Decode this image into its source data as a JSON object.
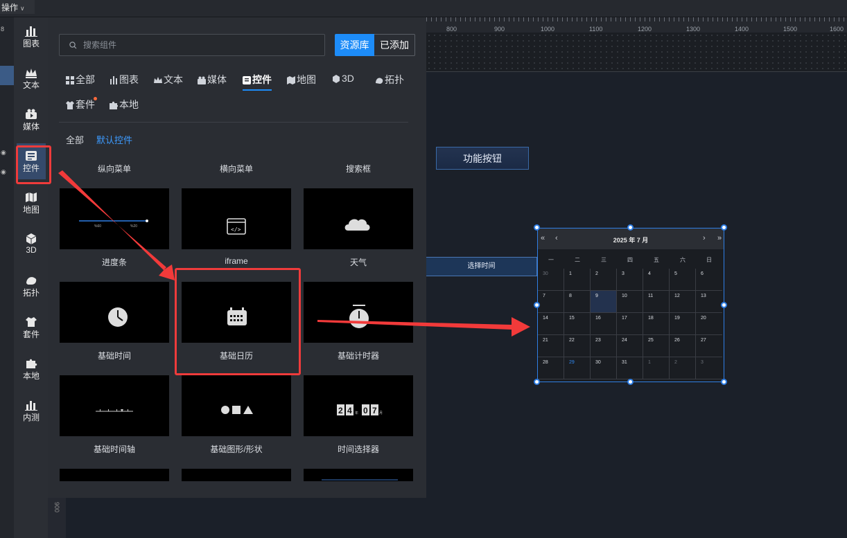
{
  "topbar": {
    "menu_label": "操作"
  },
  "rail": [
    {
      "label": "图表",
      "icon": "bar-chart-icon"
    },
    {
      "label": "文本",
      "icon": "crown-text-icon"
    },
    {
      "label": "媒体",
      "icon": "media-icon"
    },
    {
      "label": "控件",
      "icon": "widget-icon"
    },
    {
      "label": "地图",
      "icon": "map-icon"
    },
    {
      "label": "3D",
      "icon": "cube-icon"
    },
    {
      "label": "拓扑",
      "icon": "topology-icon"
    },
    {
      "label": "套件",
      "icon": "shirt-suite-icon"
    },
    {
      "label": "本地",
      "icon": "puzzle-icon"
    },
    {
      "label": "内测",
      "icon": "beta-chart-icon"
    }
  ],
  "panel": {
    "search_placeholder": "搜索组件",
    "btn_library": "资源库",
    "btn_added": "已添加",
    "categories": [
      "全部",
      "图表",
      "文本",
      "媒体",
      "控件",
      "地图",
      "3D",
      "拓扑",
      "套件",
      "本地"
    ],
    "subcategories": [
      "全部",
      "默认控件"
    ],
    "top_labels": [
      "纵向菜单",
      "横向菜单",
      "搜索框"
    ],
    "components": [
      {
        "label": "进度条"
      },
      {
        "label": "iframe"
      },
      {
        "label": "天气"
      },
      {
        "label": "基础时间"
      },
      {
        "label": "基础日历"
      },
      {
        "label": "基础计时器"
      },
      {
        "label": "基础时间轴"
      },
      {
        "label": "基础图形/形状"
      },
      {
        "label": "时间选择器"
      }
    ],
    "thumb_texts": {
      "progress_a": "%60",
      "progress_b": "%20",
      "timer_digits": [
        "2",
        "4",
        "0",
        "7"
      ],
      "timer_units": [
        "年",
        "月"
      ]
    }
  },
  "ruler": {
    "ticks": [
      "800",
      "900",
      "1000",
      "1100",
      "1200",
      "1300",
      "1400",
      "1500",
      "1600"
    ],
    "vertical": "900"
  },
  "canvas": {
    "func_button": "功能按钮",
    "time_bar": "选择时间"
  },
  "calendar": {
    "title": "2025 年 7 月",
    "nav": [
      "«",
      "‹",
      "›",
      "»"
    ],
    "weekdays": [
      "一",
      "二",
      "三",
      "四",
      "五",
      "六",
      "日"
    ],
    "days": [
      "30",
      "1",
      "2",
      "3",
      "4",
      "5",
      "6",
      "7",
      "8",
      "9",
      "10",
      "11",
      "12",
      "13",
      "14",
      "15",
      "16",
      "17",
      "18",
      "19",
      "20",
      "21",
      "22",
      "23",
      "24",
      "25",
      "26",
      "27",
      "28",
      "29",
      "30",
      "31",
      "1",
      "2",
      "3"
    ],
    "muted_idx": [
      0,
      32,
      33,
      34
    ],
    "today_idx": 9,
    "accent_idx": 29
  },
  "colors": {
    "accent": "#1d8cf8",
    "highlight_box": "#ef3b3b",
    "selection": "#2f7fe6"
  }
}
